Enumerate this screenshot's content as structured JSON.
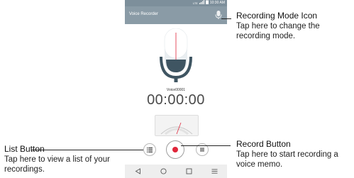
{
  "status_bar": {
    "time": "10:30 AM",
    "network": "LTE"
  },
  "app_bar": {
    "title": "Voice Recorder",
    "mode_icon": "microphone-icon"
  },
  "recorder": {
    "file_name": "Voice00001",
    "elapsed_time": "00:00:00"
  },
  "controls": {
    "list_icon": "list-icon",
    "record_icon": "record-dot-icon",
    "stop_icon": "stop-square-icon"
  },
  "nav_bar": {
    "back_icon": "back-triangle-icon",
    "home_icon": "home-circle-icon",
    "recents_icon": "recents-square-icon",
    "menu_icon": "menu-lines-icon"
  },
  "annotations": {
    "recording_mode": {
      "title": "Recording Mode Icon",
      "desc": "Tap here to change the recording mode."
    },
    "record": {
      "title": "Record Button",
      "desc": "Tap here to start recording a voice memo."
    },
    "list": {
      "title": "List Button",
      "desc": "Tap here to view a list of your recordings."
    }
  },
  "colors": {
    "app_bar": "#8a9ba6",
    "accent_red": "#e0263a",
    "mic_body": "#3f5562"
  }
}
